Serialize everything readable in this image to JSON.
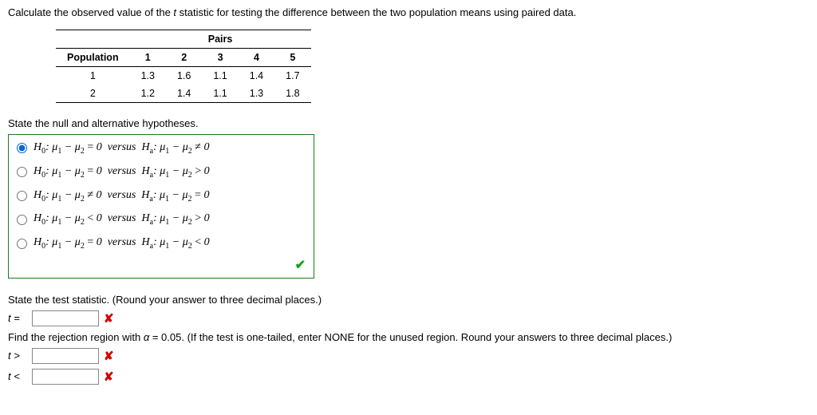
{
  "intro": {
    "line1_pre": "Calculate the observed value of the ",
    "line1_t": "t",
    "line1_post": " statistic for testing the difference between the two population means using paired data."
  },
  "table": {
    "pairs_label": "Pairs",
    "pop_label": "Population",
    "cols": [
      "1",
      "2",
      "3",
      "4",
      "5"
    ],
    "rows": [
      {
        "pop": "1",
        "vals": [
          "1.3",
          "1.6",
          "1.1",
          "1.4",
          "1.7"
        ]
      },
      {
        "pop": "2",
        "vals": [
          "1.2",
          "1.4",
          "1.1",
          "1.3",
          "1.8"
        ]
      }
    ]
  },
  "hyp_prompt": "State the null and alternative hypotheses.",
  "hypotheses": [
    {
      "h0_rel": "=",
      "ha_rel": "≠",
      "checked": true
    },
    {
      "h0_rel": "=",
      "ha_rel": ">",
      "checked": false
    },
    {
      "h0_rel": "≠",
      "ha_rel": "=",
      "checked": false
    },
    {
      "h0_rel": "<",
      "ha_rel": ">",
      "checked": false
    },
    {
      "h0_rel": "=",
      "ha_rel": "<",
      "checked": false
    }
  ],
  "stat_prompt": "State the test statistic. (Round your answer to three decimal places.)",
  "t_label": "t",
  "eq_sign": "=",
  "rr_prompt_pre": "Find the rejection region with ",
  "rr_alpha": "α",
  "rr_prompt_mid": " = 0.05. (If the test is one-tailed, enter NONE for the unused region. Round your answers to three decimal places.)",
  "gt_sign": ">",
  "lt_sign": "<"
}
